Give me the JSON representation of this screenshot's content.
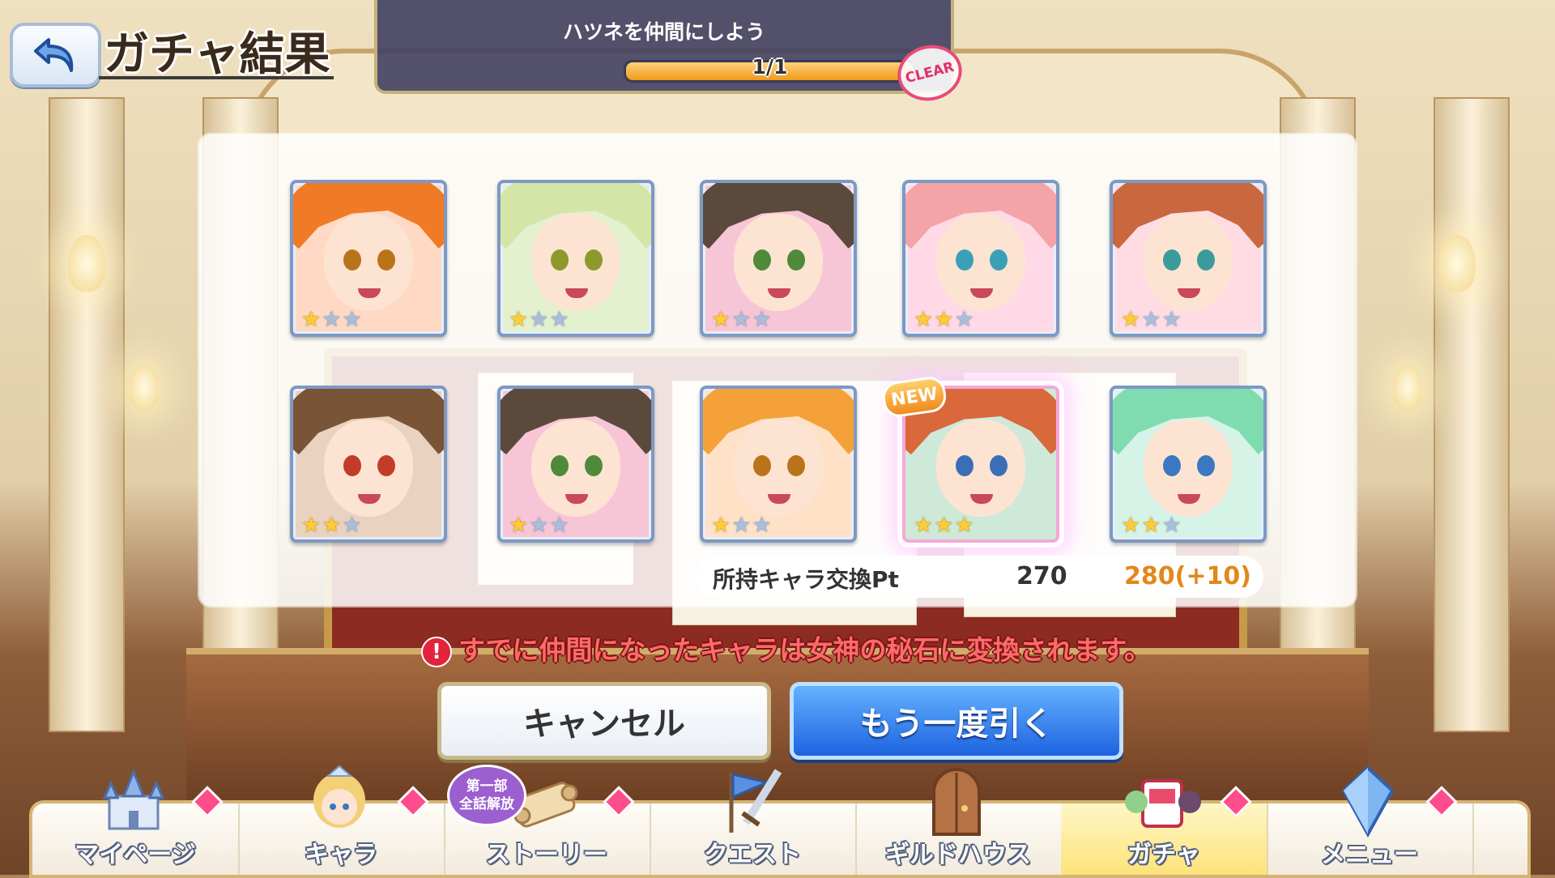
{
  "header": {
    "title": "ガチャ結果",
    "back_icon": "back-arrow-icon"
  },
  "mission": {
    "text": "ハツネを仲間にしよう",
    "progress_text": "1/1",
    "progress_value": 1.0,
    "badge": "CLEAR"
  },
  "results": {
    "cards": [
      {
        "stars": 1,
        "max_stars": 3,
        "hair": "#f07a25",
        "eyes": "#b9741a",
        "bg": "#ffd9c4",
        "new": false
      },
      {
        "stars": 1,
        "max_stars": 3,
        "hair": "#d5e5a8",
        "eyes": "#8c9a2c",
        "bg": "#e3f1cf",
        "new": false
      },
      {
        "stars": 1,
        "max_stars": 3,
        "hair": "#5b4a3c",
        "eyes": "#4f8a3a",
        "bg": "#f7c6d6",
        "new": false
      },
      {
        "stars": 2,
        "max_stars": 3,
        "hair": "#f4a3a6",
        "eyes": "#3aa0b8",
        "bg": "#ffd9e6",
        "new": false
      },
      {
        "stars": 1,
        "max_stars": 3,
        "hair": "#c9683f",
        "eyes": "#3a9c9a",
        "bg": "#ffdce4",
        "new": false
      },
      {
        "stars": 2,
        "max_stars": 3,
        "hair": "#7a5436",
        "eyes": "#c13d2a",
        "bg": "#e9d3c0",
        "new": false
      },
      {
        "stars": 1,
        "max_stars": 3,
        "hair": "#5b4a3c",
        "eyes": "#4f8a3a",
        "bg": "#f7c6d6",
        "new": false
      },
      {
        "stars": 1,
        "max_stars": 3,
        "hair": "#f4a13a",
        "eyes": "#b9741a",
        "bg": "#ffe1c8",
        "new": false
      },
      {
        "stars": 3,
        "max_stars": 3,
        "hair": "#d9683a",
        "eyes": "#3a6fb8",
        "bg": "#cfe9d9",
        "new": true
      },
      {
        "stars": 2,
        "max_stars": 3,
        "hair": "#7fdbb0",
        "eyes": "#3a78c2",
        "bg": "#d6f3e8",
        "new": false
      }
    ],
    "new_label": "NEW",
    "points_label": "所持キャラ交換Pt",
    "points_current": "270",
    "points_new": "280(+10)"
  },
  "warning": {
    "icon": "!",
    "text": "すでに仲間になったキャラは女神の秘石に変換されます。"
  },
  "buttons": {
    "cancel": "キャンセル",
    "again": "もう一度引く"
  },
  "nav": {
    "items": [
      {
        "label": "マイページ",
        "icon": "castle-icon",
        "badge": true,
        "active": false
      },
      {
        "label": "キャラ",
        "icon": "character-icon",
        "badge": true,
        "active": false
      },
      {
        "label": "ストーリー",
        "icon": "scroll-icon",
        "badge": true,
        "active": false
      },
      {
        "label": "クエスト",
        "icon": "sword-flag-icon",
        "badge": false,
        "active": false
      },
      {
        "label": "ギルドハウス",
        "icon": "door-icon",
        "badge": false,
        "active": false
      },
      {
        "label": "ガチャ",
        "icon": "gacha-icon",
        "badge": true,
        "active": true
      },
      {
        "label": "メニュー",
        "icon": "crystal-icon",
        "badge": true,
        "active": false
      }
    ],
    "story_badge_line1": "第一部",
    "story_badge_line2": "全話解放"
  },
  "colors": {
    "accent_blue": "#1d63e0",
    "point_orange": "#e3871b",
    "warning_red": "#ff6a6a",
    "badge_pink": "#ff4c8a"
  }
}
